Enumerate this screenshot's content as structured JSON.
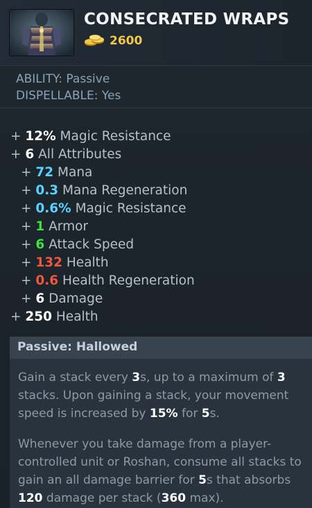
{
  "item": {
    "name": "CONSECRATED WRAPS",
    "cost": "2600",
    "icon": "consecrated-wraps-item-icon",
    "gold_icon": "gold-coins-icon"
  },
  "meta": {
    "ability": "ABILITY: Passive",
    "dispellable": "DISPELLABLE: Yes"
  },
  "attributes": [
    {
      "plus": "+ ",
      "value": "12%",
      "label": " Magic Resistance",
      "color": "#ffffff"
    },
    {
      "plus": "+ ",
      "value": "6",
      "label": " All Attributes",
      "color": "#ffffff"
    },
    {
      "plus": "+ ",
      "value": "72",
      "label": " Mana",
      "color": "#59d2ff"
    },
    {
      "plus": "+ ",
      "value": "0.3",
      "label": " Mana Regeneration",
      "color": "#59d2ff"
    },
    {
      "plus": "+ ",
      "value": "0.6%",
      "label": " Magic Resistance",
      "color": "#59d2ff"
    },
    {
      "plus": "+ ",
      "value": "1",
      "label": " Armor",
      "color": "#3ce43c"
    },
    {
      "plus": "+ ",
      "value": "6",
      "label": " Attack Speed",
      "color": "#3ce43c"
    },
    {
      "plus": "+ ",
      "value": "132",
      "label": " Health",
      "color": "#f0573c"
    },
    {
      "plus": "+ ",
      "value": "0.6",
      "label": " Health Regeneration",
      "color": "#f0573c"
    },
    {
      "plus": "+ ",
      "value": "6",
      "label": " Damage",
      "color": "#ffffff"
    },
    {
      "plus": "+ ",
      "value": "250",
      "label": " Health",
      "color": "#ffffff"
    }
  ],
  "ability": {
    "title": "Passive: Hallowed",
    "p1": {
      "t1": "Gain a stack every ",
      "v1": "3",
      "t2": "s, up to a maximum of ",
      "v2": "3",
      "t3": " stacks. Upon gaining a stack, your movement speed is increased by ",
      "v3": "15%",
      "t4": " for ",
      "v4": "5",
      "t5": "s."
    },
    "p2": {
      "t1": "Whenever you take damage from a player-controlled unit or Roshan, consume all stacks to gain an all damage barrier for ",
      "v1": "5",
      "t2": "s that absorbs ",
      "v2": "120",
      "t3": " damage per stack (",
      "v3": "360",
      "t4": " max)."
    }
  }
}
